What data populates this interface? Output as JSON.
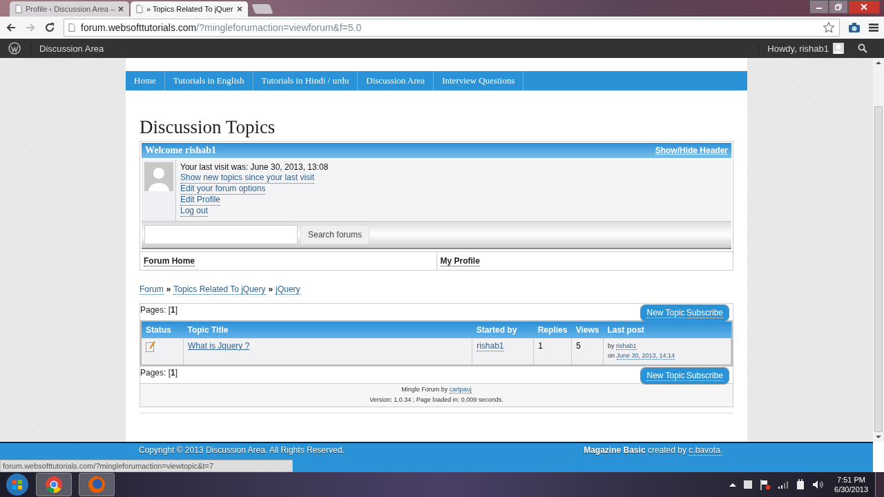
{
  "browser": {
    "tabs": [
      {
        "title": "Profile ‹ Discussion Area –",
        "selected": false
      },
      {
        "title": "» Topics Related To jQuer",
        "selected": true
      }
    ],
    "address": {
      "host": "forum.websofttutorials.com",
      "path": "/?mingleforumaction=viewforum&f=5.0"
    }
  },
  "admin_bar": {
    "site": "Discussion Area",
    "greeting": "Howdy, rishab1"
  },
  "nav": [
    {
      "label": "Home"
    },
    {
      "label": "Tutorials in English"
    },
    {
      "label": "Tutorials in Hindi / urdu"
    },
    {
      "label": "Discussion Area"
    },
    {
      "label": "Interview Questions"
    }
  ],
  "heading": "Discussion Topics",
  "welcome": {
    "title": "Welcome rishab1",
    "toggle": "Show/Hide Header",
    "last_visit": "Your last visit was: June 30, 2013, 13:08",
    "links": [
      "Show new topics since your last visit",
      "Edit your forum options",
      "Edit Profile",
      "Log out"
    ]
  },
  "search": {
    "button": "Search forums"
  },
  "quick_links": [
    "Forum Home",
    "My Profile"
  ],
  "breadcrumb": {
    "items": [
      "Forum",
      "Topics Related To jQuery",
      "jQuery"
    ],
    "separator": "»"
  },
  "pages_top": "Pages: [**1**]",
  "actions_top": [
    "New Topic",
    "Subscribe"
  ],
  "table": {
    "columns": [
      "Status",
      "Topic Title",
      "Started by",
      "Replies",
      "Views",
      "Last post"
    ],
    "rows": [
      {
        "title": "What is Jquery ?",
        "started_by": "rishab1",
        "replies": "1",
        "views": "5",
        "last_by_prefix": "by",
        "last_by": "rishab1",
        "last_on_prefix": "on",
        "last_on": "June 30, 2013, 14:14"
      }
    ]
  },
  "pages_bottom": "Pages: [**1**]",
  "actions_bottom": [
    "New Topic",
    "Subscribe"
  ],
  "forum_footer": {
    "credit": "Mingle Forum by",
    "author": "cartpauj",
    "version": "Version: 1.0.34 ; Page loaded in: 0.009 seconds."
  },
  "footer": {
    "copyright": "Copyright © 2013 Discussion Area. All Rights Reserved.",
    "theme": "Magazine Basic",
    "created": "created by",
    "author": "c.bavota."
  },
  "status_url": "forum.websofttutorials.com/?mingleforumaction=viewtopic&t=7",
  "taskbar": {
    "time": "7:51 PM",
    "date": "6/30/2013"
  }
}
